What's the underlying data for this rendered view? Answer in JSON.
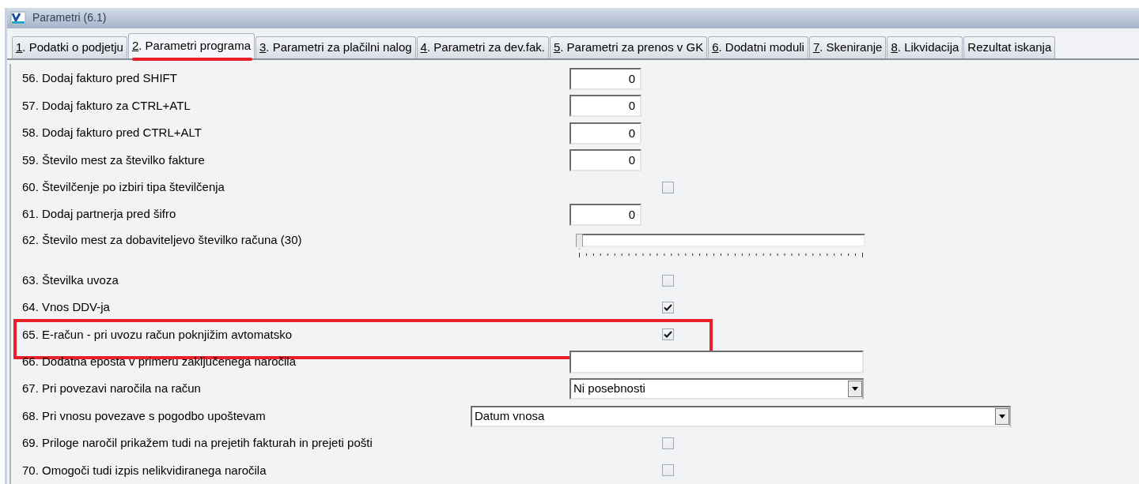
{
  "window": {
    "title": "Parametri  (6.1)"
  },
  "tabs": [
    {
      "key": "1",
      "label": ". Podatki o podjetju",
      "selected": false,
      "marked": false
    },
    {
      "key": "2",
      "label": ". Parametri programa",
      "selected": true,
      "marked": true
    },
    {
      "key": "3",
      "label": ". Parametri za plačilni nalog",
      "selected": false,
      "marked": false
    },
    {
      "key": "4",
      "label": ". Parametri za dev.fak.",
      "selected": false,
      "marked": false
    },
    {
      "key": "5",
      "label": ". Parametri za prenos v GK",
      "selected": false,
      "marked": false
    },
    {
      "key": "6",
      "label": ". Dodatni moduli",
      "selected": false,
      "marked": false
    },
    {
      "key": "7",
      "label": ". Skeniranje",
      "selected": false,
      "marked": false
    },
    {
      "key": "8",
      "label": ". Likvidacija",
      "selected": false,
      "marked": false
    },
    {
      "label": "Rezultat iskanja",
      "selected": false,
      "marked": false
    }
  ],
  "rows": [
    {
      "label": "56. Dodaj fakturo pred SHIFT",
      "kind": "number",
      "value": "0"
    },
    {
      "label": "57. Dodaj fakturo za CTRL+ATL",
      "kind": "number",
      "value": "0"
    },
    {
      "label": "58. Dodaj fakturo pred CTRL+ALT",
      "kind": "number",
      "value": "0"
    },
    {
      "label": "59. Število mest za številko fakture",
      "kind": "number",
      "value": "0"
    },
    {
      "label": "60. Številčenje po izbiri tipa številčenja",
      "kind": "checkbox",
      "checked": false
    },
    {
      "label": "61. Dodaj partnerja pred šifro",
      "kind": "number",
      "value": "0"
    },
    {
      "label": "62. Število mest za dobaviteljevo številko računa  (30)",
      "kind": "slider",
      "level": 0
    },
    {
      "label": "63. Številka uvoza",
      "kind": "checkbox",
      "checked": false
    },
    {
      "label": "64. Vnos DDV-ja",
      "kind": "checkbox",
      "checked": true
    },
    {
      "label": "65. E-račun - pri uvozu račun poknjižim avtomatsko",
      "kind": "checkbox",
      "checked": true,
      "highlighted": true
    },
    {
      "label": "66. Dodatna eposta v primeru zaključenega naročila",
      "kind": "text"
    },
    {
      "label": "67. Pri povezavi naročila na račun",
      "kind": "select",
      "value": "Ni posebnosti"
    },
    {
      "label": "68. Pri vnosu povezave s pogodbo upoštevam",
      "kind": "wideselect",
      "value": "Datum vnosa"
    },
    {
      "label": "69. Priloge naročil prikažem tudi na prejetih fakturah in prejeti pošti",
      "kind": "checkbox",
      "checked": false
    },
    {
      "label": "70. Omogoči tudi izpis nelikvidiranega naročila",
      "kind": "checkbox",
      "checked": false
    }
  ]
}
